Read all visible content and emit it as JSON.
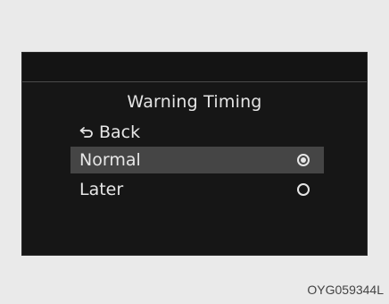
{
  "menu": {
    "title": "Warning Timing",
    "back_label": "Back",
    "options": [
      {
        "label": "Normal",
        "selected": true
      },
      {
        "label": "Later",
        "selected": false
      }
    ]
  },
  "figure_code": "OYG059344L",
  "colors": {
    "screen_bg": "#161616",
    "highlight": "#454545",
    "text": "#e6e6e6",
    "page_bg": "#eaeaea"
  },
  "icons": {
    "back": "back-arrow-icon",
    "radio_selected": "radio-selected-icon",
    "radio_unselected": "radio-unselected-icon"
  }
}
